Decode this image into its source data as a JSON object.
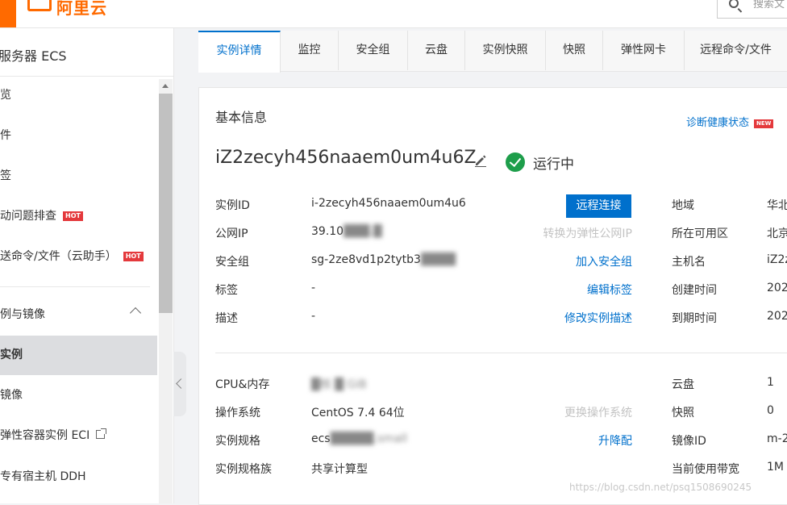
{
  "brand": {
    "name": "阿里云",
    "color": "#ff6a00"
  },
  "search": {
    "placeholder": "搜索文"
  },
  "sidebar": {
    "title": "服务器 ECS",
    "items": [
      {
        "label": "览"
      },
      {
        "label": "件"
      },
      {
        "label": "签"
      },
      {
        "label": "动问题排查",
        "badge": "HOT"
      },
      {
        "label": "送命令/文件（云助手）",
        "badge": "HOT"
      },
      {
        "label": "例与镜像",
        "expanded": true
      },
      {
        "label": "实例",
        "active": true
      },
      {
        "label": "镜像"
      },
      {
        "label": "弹性容器实例 ECI",
        "external": true
      },
      {
        "label": "专有宿主机 DDH"
      }
    ]
  },
  "tabs": [
    {
      "label": "实例详情",
      "active": true
    },
    {
      "label": "监控"
    },
    {
      "label": "安全组"
    },
    {
      "label": "云盘"
    },
    {
      "label": "实例快照"
    },
    {
      "label": "快照"
    },
    {
      "label": "弹性网卡"
    },
    {
      "label": "远程命令/文件"
    }
  ],
  "panel": {
    "title": "基本信息",
    "diagnose_link": "诊断健康状态",
    "diagnose_badge": "NEW",
    "instance_name": "iZ2zecyh456naaem0um4u6Z",
    "status": "运行中",
    "status_color": "#1e9e4b",
    "rows": [
      {
        "label": "实例ID",
        "value": "i-2zecyh456naaem0um4u6",
        "action": "远程连接",
        "right_label": "地域",
        "right_value": "华北"
      },
      {
        "label": "公网IP",
        "value": "39.10",
        "value_hidden": "███.█",
        "action": "转换为弹性公网IP",
        "action_disabled": true,
        "right_label": "所在可用区",
        "right_value": "北京"
      },
      {
        "label": "安全组",
        "value": "sg-2ze8vd1p2tytb3",
        "value_hidden": "████",
        "action": "加入安全组",
        "right_label": "主机名",
        "right_value": "iZ2z"
      },
      {
        "label": "标签",
        "value": "-",
        "action": "编辑标签",
        "right_label": "创建时间",
        "right_value": "202"
      },
      {
        "label": "描述",
        "value": "-",
        "action": "修改实例描述",
        "right_label": "到期时间",
        "right_value": "202"
      }
    ],
    "rows2": [
      {
        "label": "CPU&内存",
        "value": "█核 █ GiB",
        "right_label": "云盘",
        "right_value": "1"
      },
      {
        "label": "操作系统",
        "value": "CentOS 7.4 64位",
        "action": "更换操作系统",
        "action_disabled": true,
        "right_label": "快照",
        "right_value": "0"
      },
      {
        "label": "实例规格",
        "value": "ecs",
        "value_hidden": "█████.small",
        "action": "升降配",
        "right_label": "镜像ID",
        "right_value": "m-2"
      },
      {
        "label": "实例规格族",
        "value": "共享计算型",
        "right_label": "当前使用带宽",
        "right_value": "1M"
      }
    ]
  },
  "watermark": "https://blog.csdn.net/psq1508690245"
}
